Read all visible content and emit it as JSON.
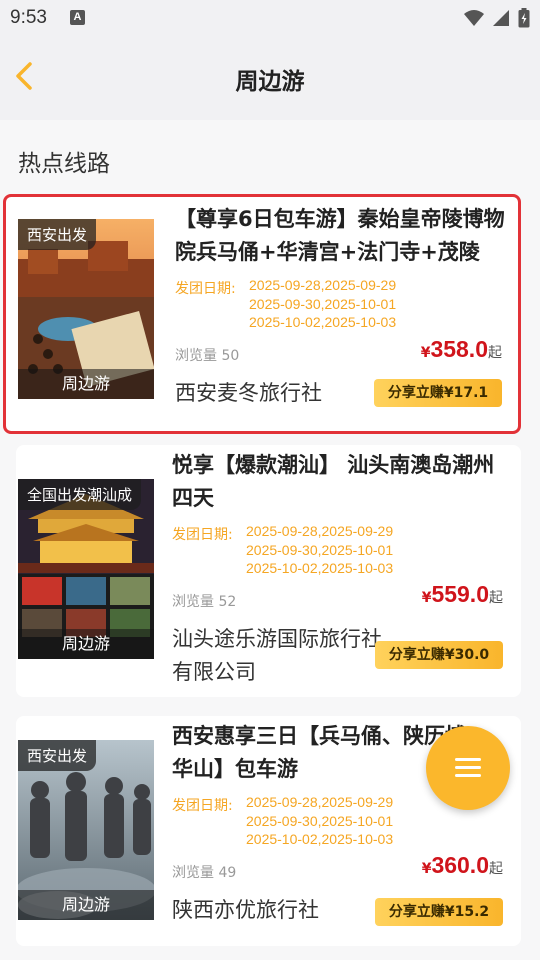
{
  "status_bar": {
    "time": "9:53",
    "notification_icon": "A"
  },
  "header": {
    "title": "周边游"
  },
  "section": {
    "title": "热点线路"
  },
  "routes": [
    {
      "tag": "西安出发",
      "category": "周边游",
      "title": "【尊享6日包车游】秦始皇帝陵博物院兵马俑+华清宫+法门寺+茂陵",
      "date_label": "发团日期:",
      "dates": [
        "2025-09-28,2025-09-29",
        "2025-09-30,2025-10-01",
        "2025-10-02,2025-10-03"
      ],
      "views": "浏览量 50",
      "currency": "¥",
      "price": "358.0",
      "price_suffix": "起",
      "agency": "西安麦冬旅行社",
      "share": "分享立赚¥17.1"
    },
    {
      "tag": "全国出发潮汕成",
      "category": "周边游",
      "title": "悦享【爆款潮汕】 汕头南澳岛潮州四天",
      "date_label": "发团日期:",
      "dates": [
        "2025-09-28,2025-09-29",
        "2025-09-30,2025-10-01",
        "2025-10-02,2025-10-03"
      ],
      "views": "浏览量 52",
      "currency": "¥",
      "price": "559.0",
      "price_suffix": "起",
      "agency": "汕头途乐游国际旅行社有限公司",
      "share": "分享立赚¥30.0"
    },
    {
      "tag": "西安出发",
      "category": "周边游",
      "title": "西安惠享三日【兵马俑、陕历博、华山】包车游",
      "date_label": "发团日期:",
      "dates": [
        "2025-09-28,2025-09-29",
        "2025-09-30,2025-10-01",
        "2025-10-02,2025-10-03"
      ],
      "views": "浏览量 49",
      "currency": "¥",
      "price": "360.0",
      "price_suffix": "起",
      "agency": "陕西亦优旅行社",
      "share": "分享立赚¥15.2"
    }
  ],
  "colors": {
    "accent": "#f5a623",
    "price": "#d0141b",
    "highlight": "#e23238",
    "fab": "#fbb72c"
  }
}
